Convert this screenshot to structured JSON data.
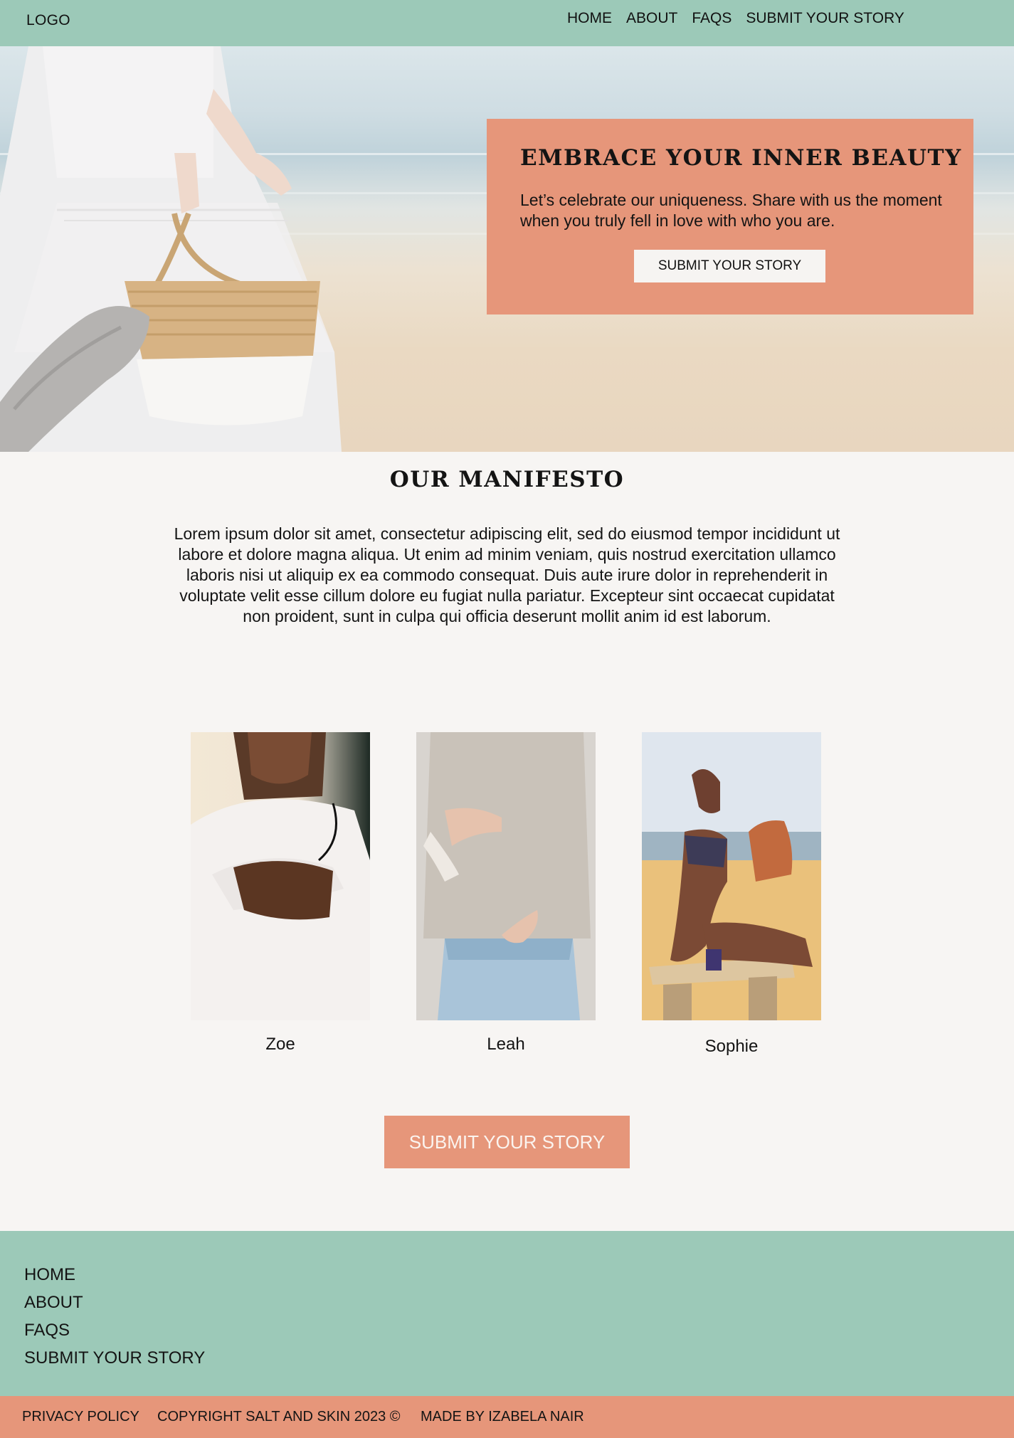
{
  "header": {
    "logo": "LOGO",
    "nav": [
      "HOME",
      "ABOUT",
      "FAQS",
      "SUBMIT YOUR STORY"
    ]
  },
  "hero": {
    "title": "EMBRACE YOUR INNER BEAUTY",
    "text": "Let’s celebrate our uniqueness. Share with us the moment when you truly fell in love with who you are.",
    "button": "SUBMIT YOUR STORY"
  },
  "manifesto": {
    "title": "OUR MANIFESTO",
    "text": "Lorem ipsum dolor sit amet, consectetur adipiscing elit, sed do eiusmod tempor incididunt ut labore et dolore magna aliqua. Ut enim ad minim veniam, quis nostrud exercitation ullamco laboris nisi ut aliquip ex ea commodo consequat. Duis aute irure dolor in reprehenderit in voluptate velit esse cillum dolore eu fugiat nulla pariatur. Excepteur sint occaecat cupidatat non proident, sunt in culpa qui officia deserunt mollit anim id est laborum."
  },
  "stories": [
    {
      "name": "Zoe"
    },
    {
      "name": "Leah"
    },
    {
      "name": "Sophie"
    }
  ],
  "cta": {
    "label": "SUBMIT YOUR STORY"
  },
  "footer": {
    "nav": [
      "HOME",
      "ABOUT",
      "FAQS",
      "SUBMIT YOUR STORY"
    ],
    "privacy": "PRIVACY POLICY",
    "copyright": "COPYRIGHT SALT AND SKIN 2023 ©",
    "credit": "MADE BY IZABELA NAIR"
  },
  "colors": {
    "mint": "#9cc9b8",
    "coral": "#e6967a",
    "background": "#f7f5f3"
  }
}
